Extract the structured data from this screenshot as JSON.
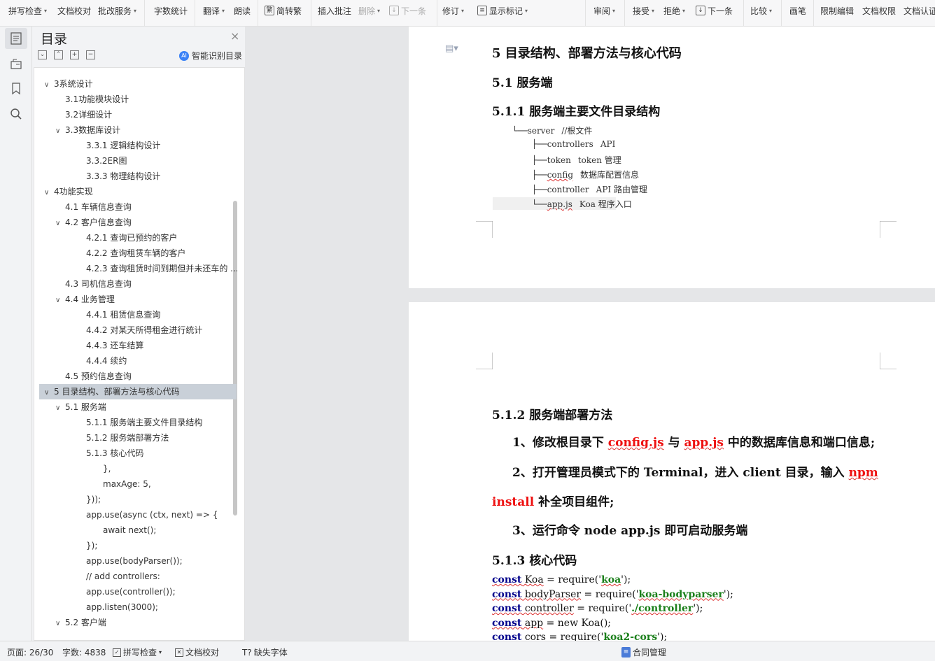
{
  "toolbar": {
    "items": [
      {
        "label": "拼写检查",
        "caret": true
      },
      {
        "label": "文档校对",
        "caret": false
      },
      {
        "label": "批改服务",
        "caret": true
      },
      {
        "label": "字数统计",
        "caret": false
      },
      {
        "label": "翻译",
        "caret": true
      },
      {
        "label": "朗读",
        "caret": false
      },
      {
        "label": "简转繁",
        "caret": false
      },
      {
        "label": "插入批注",
        "caret": false
      },
      {
        "label": "删除",
        "caret": true
      },
      {
        "label": "下一条",
        "caret": false
      },
      {
        "label": "修订",
        "caret": true
      },
      {
        "label": "显示标记",
        "caret": true
      },
      {
        "label": "审阅",
        "caret": true
      },
      {
        "label": "接受",
        "caret": true
      },
      {
        "label": "拒绝",
        "caret": true
      },
      {
        "label": "下一条",
        "caret": false
      },
      {
        "label": "比较",
        "caret": true
      },
      {
        "label": "画笔",
        "caret": false
      },
      {
        "label": "限制编辑",
        "caret": false
      },
      {
        "label": "文档权限",
        "caret": false
      },
      {
        "label": "文档认证",
        "caret": false
      }
    ]
  },
  "toc": {
    "title": "目录",
    "smart_label": "智能识别目录",
    "items": [
      {
        "label": "3系统设计",
        "level": 1,
        "arrow": "v"
      },
      {
        "label": "3.1功能模块设计",
        "level": 2,
        "arrow": ""
      },
      {
        "label": "3.2详细设计",
        "level": 2,
        "arrow": ""
      },
      {
        "label": "3.3数据库设计",
        "level": 2,
        "arrow": "v"
      },
      {
        "label": "3.3.1  逻辑结构设计",
        "level": 3,
        "arrow": ""
      },
      {
        "label": "3.3.2ER图",
        "level": 3,
        "arrow": ""
      },
      {
        "label": "3.3.3  物理结构设计",
        "level": 3,
        "arrow": ""
      },
      {
        "label": "4功能实现",
        "level": 1,
        "arrow": "v"
      },
      {
        "label": "4.1  车辆信息查询",
        "level": 2,
        "arrow": ""
      },
      {
        "label": "4.2 客户信息查询",
        "level": 2,
        "arrow": "v"
      },
      {
        "label": "4.2.1 查询已预约的客户",
        "level": 3,
        "arrow": ""
      },
      {
        "label": "4.2.2 查询租赁车辆的客户",
        "level": 3,
        "arrow": ""
      },
      {
        "label": "4.2.3 查询租赁时间到期但并未还车的 ...",
        "level": 3,
        "arrow": ""
      },
      {
        "label": "4.3 司机信息查询",
        "level": 2,
        "arrow": ""
      },
      {
        "label": "4.4 业务管理",
        "level": 2,
        "arrow": "v"
      },
      {
        "label": "4.4.1  租赁信息查询",
        "level": 3,
        "arrow": ""
      },
      {
        "label": "4.4.2  对某天所得租金进行统计",
        "level": 3,
        "arrow": ""
      },
      {
        "label": "4.4.3  还车结算",
        "level": 3,
        "arrow": ""
      },
      {
        "label": "4.4.4  续约",
        "level": 3,
        "arrow": ""
      },
      {
        "label": "4.5 预约信息查询",
        "level": 2,
        "arrow": ""
      },
      {
        "label": "5  目录结构、部署方法与核心代码",
        "level": 1,
        "arrow": "v",
        "highlight": true
      },
      {
        "label": "5.1 服务端",
        "level": 2,
        "arrow": "v"
      },
      {
        "label": "5.1.1 服务端主要文件目录结构",
        "level": 3,
        "arrow": ""
      },
      {
        "label": "5.1.2 服务端部署方法",
        "level": 3,
        "arrow": ""
      },
      {
        "label": "5.1.3  核心代码",
        "level": 3,
        "arrow": ""
      },
      {
        "label": "},",
        "level": 4,
        "arrow": ""
      },
      {
        "label": "maxAge: 5,",
        "level": 4,
        "arrow": ""
      },
      {
        "label": "}));",
        "level": 3,
        "arrow": ""
      },
      {
        "label": "app.use(async (ctx, next) => {",
        "level": 3,
        "arrow": ""
      },
      {
        "label": "await next();",
        "level": 4,
        "arrow": ""
      },
      {
        "label": "});",
        "level": 3,
        "arrow": ""
      },
      {
        "label": "app.use(bodyParser());",
        "level": 3,
        "arrow": ""
      },
      {
        "label": "// add controllers:",
        "level": 3,
        "arrow": ""
      },
      {
        "label": "app.use(controller());",
        "level": 3,
        "arrow": ""
      },
      {
        "label": "app.listen(3000);",
        "level": 3,
        "arrow": ""
      },
      {
        "label": "5.2 客户端",
        "level": 2,
        "arrow": "v"
      }
    ]
  },
  "document": {
    "h5": "5  目录结构、部署方法与核心代码",
    "h51": "5.1 服务端",
    "h511": "5.1.1 服务端主要文件目录结构",
    "tree": [
      {
        "prefix": "└──",
        "name": "server",
        "desc": "//根文件",
        "indent": 0
      },
      {
        "prefix": "├──",
        "name": "controllers",
        "desc": "API",
        "indent": 1
      },
      {
        "prefix": "├──",
        "name": "token",
        "desc": "token 管理",
        "indent": 1
      },
      {
        "prefix": "├──",
        "name": "config",
        "desc": "数据库配置信息",
        "indent": 1
      },
      {
        "prefix": "├──",
        "name": "controller",
        "desc": "API 路由管理",
        "indent": 1
      },
      {
        "prefix": "└──",
        "name": "app.js",
        "desc": "Koa 程序入口",
        "indent": 1
      }
    ],
    "h512": "5.1.2 服务端部署方法",
    "step1_a": "1、修改根目录下 ",
    "step1_b": "config.js",
    "step1_c": " 与 ",
    "step1_d": "app.js",
    "step1_e": " 中的数据库信息和端口信息;",
    "step2_a": "2、打开管理员模式下的 Terminal，进入 client 目录，输入 ",
    "step2_b": "npm",
    "step2_c": "install",
    "step2_d": " 补全项目组件;",
    "step3": "3、运行命令 node app.js 即可启动服务端",
    "h513": "5.1.3  核心代码",
    "code": [
      {
        "kw": "const",
        "var": " Koa",
        "mid": " = require('",
        "str": "koa",
        "end": "');"
      },
      {
        "kw": "const",
        "var": " bodyParser",
        "mid": " = require('",
        "str": "koa-bodyparser",
        "end": "');"
      },
      {
        "kw": "const",
        "var": " controller",
        "mid": " = require('",
        "str": "./controller",
        "end": "');"
      },
      {
        "kw": "const",
        "var": " app",
        "mid": " = ",
        "str": "",
        "end": "new Koa();"
      },
      {
        "kw": "const",
        "var": " cors",
        "mid": " = require('",
        "str": "koa2-cors",
        "end": "');"
      }
    ]
  },
  "statusbar": {
    "page": "页面: 26/30",
    "words": "字数: 4838",
    "spell": "拼写检查",
    "proof": "文档校对",
    "missing_font": "缺失字体",
    "contract": "合同管理"
  }
}
